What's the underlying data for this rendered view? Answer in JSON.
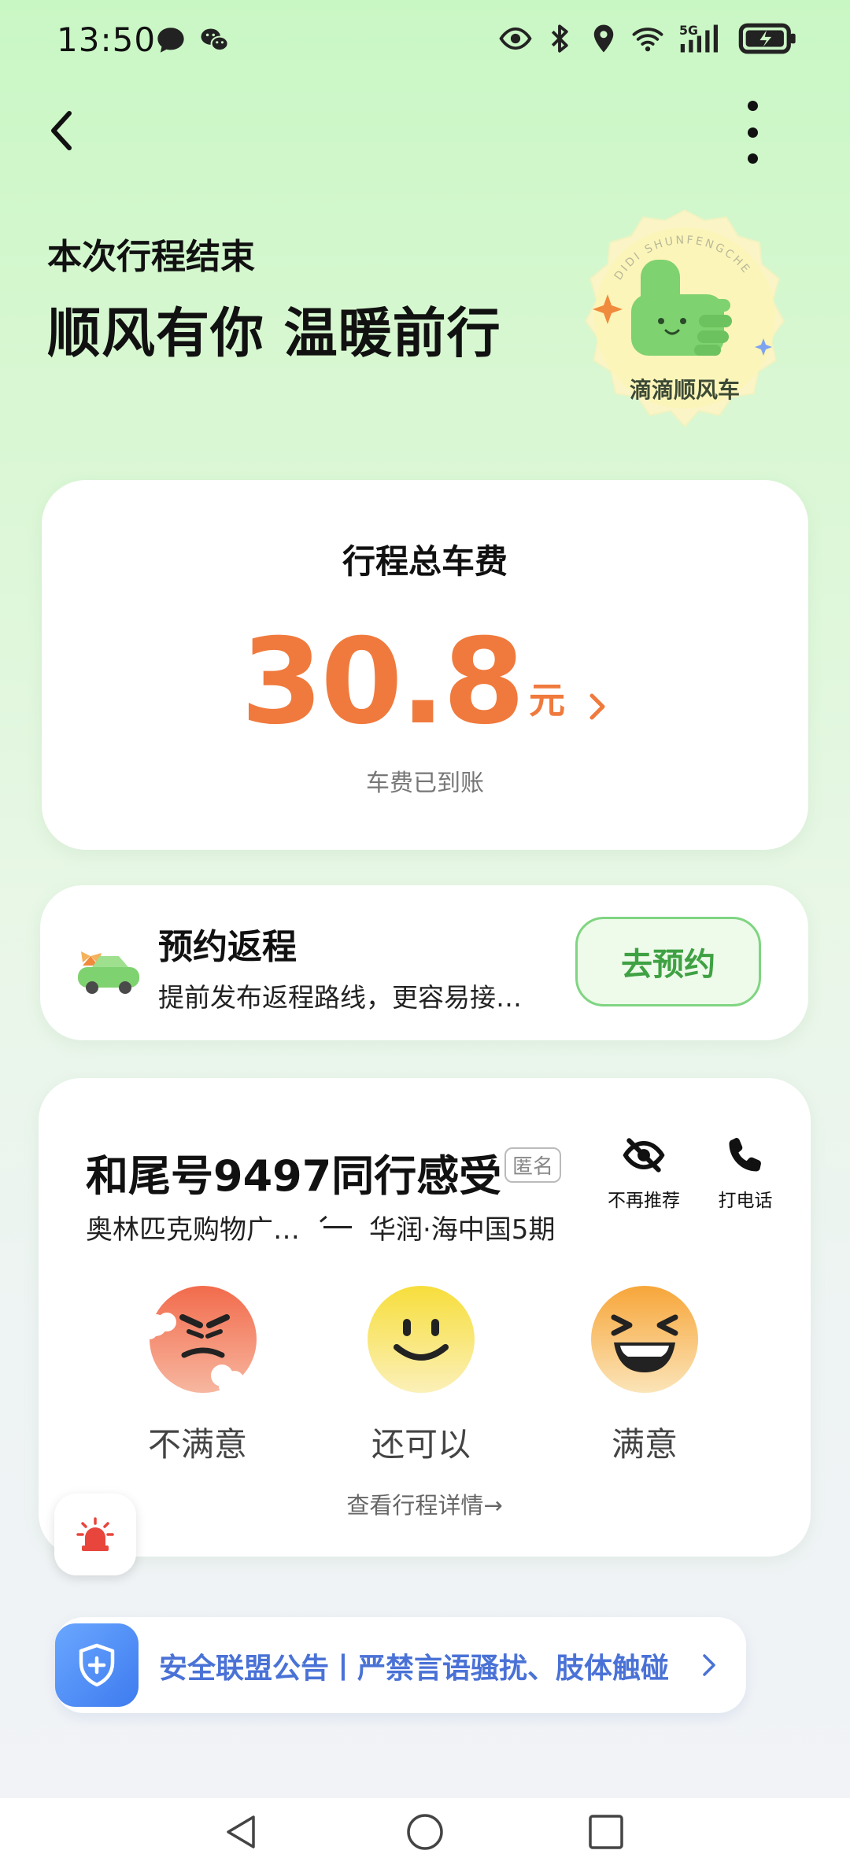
{
  "status_bar": {
    "time": "13:50",
    "left_icons": [
      "message-icon",
      "wechat-icon"
    ],
    "right_icons": [
      "eye-icon",
      "bluetooth-icon",
      "location-icon",
      "wifi-icon",
      "signal-5g-icon",
      "battery-icon"
    ],
    "network_label": "5G"
  },
  "header": {
    "subtitle": "本次行程结束",
    "title": "顺风有你 温暖前行",
    "badge": {
      "arc_text": "DIDI SHUNFENGCHE",
      "label": "滴滴顺风车"
    }
  },
  "fare": {
    "title": "行程总车费",
    "amount": "30.8",
    "unit": "元",
    "status": "车费已到账",
    "accent_color": "#f07a3d"
  },
  "return_trip": {
    "title": "预约返程",
    "description": "提前发布返程路线，更容易接…",
    "button_label": "去预约"
  },
  "feedback": {
    "title": "和尾号9497同行感受",
    "tag": "匿名",
    "route_from": "奥林匹克购物广…",
    "route_to": "华润·海中国5期",
    "actions": [
      {
        "label": "不再推荐",
        "icon": "eye-off-icon"
      },
      {
        "label": "打电话",
        "icon": "phone-icon"
      }
    ],
    "ratings": [
      {
        "label": "不满意",
        "icon": "angry-face-icon"
      },
      {
        "label": "还可以",
        "icon": "smile-face-icon"
      },
      {
        "label": "满意",
        "icon": "laugh-face-icon"
      }
    ],
    "detail_link": "查看行程详情→"
  },
  "safety_banner": {
    "text": "安全联盟公告丨严禁言语骚扰、肢体触碰",
    "icon": "shield-plus-icon",
    "color": "#4a72d6"
  },
  "sos": {
    "icon": "alarm-light-icon"
  },
  "navigation_bar": [
    "back-triangle-icon",
    "home-circle-icon",
    "recents-square-icon"
  ]
}
